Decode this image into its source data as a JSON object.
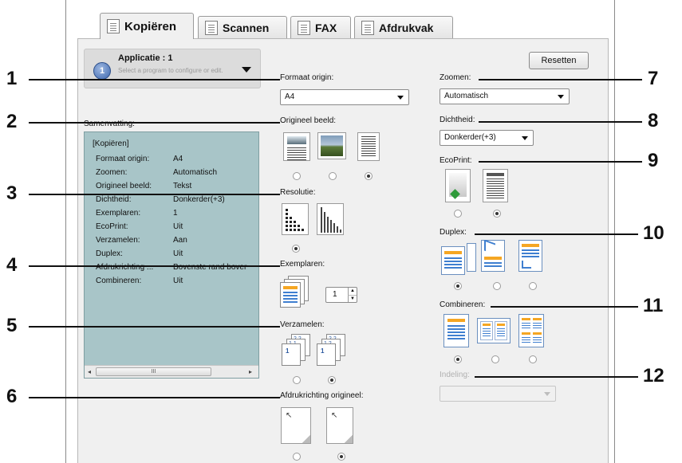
{
  "tabs": [
    {
      "label": "Kopiëren",
      "active": true
    },
    {
      "label": "Scannen",
      "active": false
    },
    {
      "label": "FAX",
      "active": false
    },
    {
      "label": "Afdrukvak",
      "active": false
    }
  ],
  "application": {
    "badge": "1",
    "title": "Applicatie : 1",
    "description": "Select a program to configure or edit."
  },
  "reset_button": "Resetten",
  "summary": {
    "label": "Samenvatting:",
    "header": "[Kopiëren]",
    "rows": [
      {
        "key": "Formaat origin:",
        "value": "A4"
      },
      {
        "key": "Zoomen:",
        "value": "Automatisch"
      },
      {
        "key": "Origineel beeld:",
        "value": "Tekst"
      },
      {
        "key": "Dichtheid:",
        "value": "Donkerder(+3)"
      },
      {
        "key": "Exemplaren:",
        "value": "1"
      },
      {
        "key": "EcoPrint:",
        "value": "Uit"
      },
      {
        "key": "Verzamelen:",
        "value": "Aan"
      },
      {
        "key": "Duplex:",
        "value": "Uit"
      },
      {
        "key": "Afdrukrichting ...",
        "value": "Bovenste rand bover"
      },
      {
        "key": "Combineren:",
        "value": "Uit"
      }
    ],
    "scroll_left": "◂",
    "scroll_thumb": "III",
    "scroll_right": "▸"
  },
  "settings": {
    "formaat_label": "Formaat origin:",
    "formaat_value": "A4",
    "origineel_label": "Origineel beeld:",
    "origineel_selected_index": 2,
    "resolutie_label": "Resolutie:",
    "resolutie_selected_index": 0,
    "exemplaren_label": "Exemplaren:",
    "exemplaren_value": "1",
    "verzamelen_label": "Verzamelen:",
    "verzamelen_selected_index": 1,
    "afdrukrichting_label": "Afdrukrichting origineel:",
    "afdrukrichting_selected_index": 1,
    "zoomen_label": "Zoomen:",
    "zoomen_value": "Automatisch",
    "dichtheid_label": "Dichtheid:",
    "dichtheid_value": "Donkerder(+3)",
    "ecoprint_label": "EcoPrint:",
    "ecoprint_selected_index": 1,
    "duplex_label": "Duplex:",
    "duplex_selected_index": 0,
    "combineren_label": "Combineren:",
    "combineren_selected_index": 0,
    "indeling_label": "Indeling:",
    "indeling_value": ""
  },
  "callouts": [
    "1",
    "2",
    "3",
    "4",
    "5",
    "6",
    "7",
    "8",
    "9",
    "10",
    "11",
    "12"
  ],
  "colors": {
    "summary_bg": "#a8c5c8",
    "panel_bg": "#f0f0f0",
    "accent_orange": "#f5a623",
    "accent_blue": "#3f7fd0"
  }
}
